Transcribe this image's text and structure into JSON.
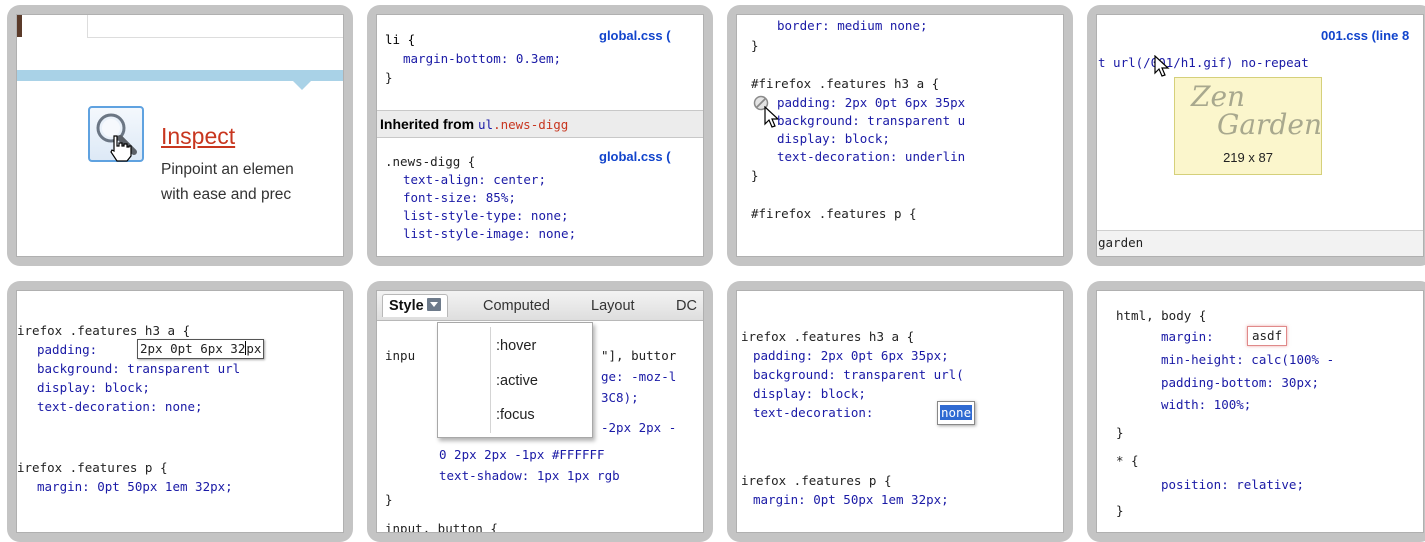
{
  "tile1": {
    "inspect_title": "Inspect",
    "inspect_desc_line1": "Pinpoint an elemen",
    "inspect_desc_line2": "with ease and prec",
    "accent_color": "#c8361f"
  },
  "tile2": {
    "rule1_selector": "li {",
    "rule1_prop": "margin-bottom: 0.3em;",
    "rule1_close": "}",
    "rule1_source": "global.css (",
    "inherited_label": "Inherited from ",
    "inherited_selector_tag": "ul",
    "inherited_selector_class": ".news-digg",
    "rule2_selector": ".news-digg {",
    "rule2_source": "global.css (",
    "rule2_props": [
      "text-align: center;",
      "font-size: 85%;",
      "list-style-type: none;",
      "list-style-image: none;"
    ]
  },
  "tile3": {
    "line_top": "border: medium none;",
    "close1": "}",
    "rule_selector": "#firefox .features h3 a {",
    "props": [
      "padding: 2px 0pt 6px 35px",
      "background: transparent u",
      "display: block;",
      "text-decoration: underlin"
    ],
    "close2": "}",
    "next_selector": "#firefox .features p {"
  },
  "tile4": {
    "source": "001.css (line 8",
    "code_line": "t url(/001/h1.gif) no-repeat",
    "zen_word1": "Zen",
    "zen_word2": "Garden",
    "image_dims": "219 x 87",
    "garden_label": "garden"
  },
  "tile5": {
    "rule_selector": "irefox .features h3 a {",
    "padding_prop": "padding:",
    "padding_value_before_caret": "2px 0pt 6px 32",
    "padding_value_after_caret": "px",
    "props": [
      "background: transparent url",
      "display: block;",
      "text-decoration: none;"
    ],
    "next_selector": "irefox .features p {",
    "next_prop": "margin: 0pt 50px 1em 32px;"
  },
  "tile6": {
    "tabs": [
      "Style",
      "Computed",
      "Layout",
      "DC"
    ],
    "pseudo_options": [
      ":hover",
      ":active",
      ":focus"
    ],
    "code_lines": [
      {
        "pre": "inpu",
        "post": "\"], buttor"
      },
      {
        "pre": "",
        "post": "ge: -moz-l"
      },
      {
        "pre": "",
        "post": "3C8);"
      },
      {
        "pre": "",
        "post": "-2px 2px -"
      },
      {
        "pre": "",
        "post": "0 2px 2px -1px #FFFFFF"
      },
      {
        "pre": "",
        "post": "text-shadow: 1px 1px rgb"
      },
      {
        "pre": "",
        "post": "}"
      },
      {
        "pre": "",
        "post": "input, button {"
      }
    ]
  },
  "tile7": {
    "rule_selector": "irefox .features h3 a {",
    "props": [
      "padding: 2px 0pt 6px 35px;",
      "background: transparent url(",
      "display: block;"
    ],
    "decoration_prop": "text-decoration:",
    "decoration_value": "none",
    "next_selector": "irefox .features p {",
    "next_prop": "margin: 0pt 50px 1em 32px;"
  },
  "tile8": {
    "rule_selector": "html, body {",
    "margin_prop": "margin:",
    "margin_value": "asdf",
    "props": [
      "min-height: calc(100% -",
      "padding-bottom: 30px;",
      "width: 100%;"
    ],
    "close1": "}",
    "star_selector": "* {",
    "star_prop": "position: relative;",
    "close2": "}"
  }
}
